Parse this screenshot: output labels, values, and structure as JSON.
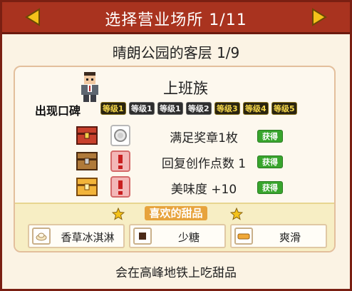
{
  "header": {
    "title": "选择营业场所 1/11"
  },
  "location": {
    "subtitle": "晴朗公园的客层 1/9"
  },
  "customer": {
    "name": "上班族",
    "appear_label": "出现口碑",
    "levels": [
      "等级1",
      "等级1",
      "等级1",
      "等级2",
      "等级3",
      "等级4",
      "等级5"
    ]
  },
  "rewards": [
    {
      "text": "满足奖章1枚",
      "status": "获得",
      "chest_color": "#c8402c",
      "condition_icon": "medal-icon"
    },
    {
      "text": "回复创作点数 1",
      "status": "获得",
      "chest_color": "#b07a3a",
      "condition_icon": "alert-icon"
    },
    {
      "text": "美味度 +10",
      "status": "获得",
      "chest_color": "#f2b43a",
      "condition_icon": "alert-icon"
    }
  ],
  "favorites": {
    "title": "喜欢的甜品",
    "items": [
      {
        "label": "香草冰淇淋",
        "icon": "ice-cream-icon"
      },
      {
        "label": "少糖",
        "icon": "sugar-block-icon"
      },
      {
        "label": "爽滑",
        "icon": "smooth-bar-icon"
      }
    ]
  },
  "footer": {
    "text": "会在高峰地铁上吃甜品"
  },
  "colors": {
    "title_bar": "#a9331f",
    "got_badge": "#38a52d",
    "fav_title": "#e7a33d",
    "arrow": "#f4c21a"
  }
}
